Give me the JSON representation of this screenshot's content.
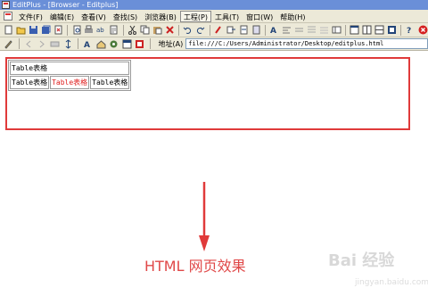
{
  "window": {
    "title": "EditPlus - [Browser - Editplus]"
  },
  "menu": {
    "items": [
      "文件(F)",
      "编辑(E)",
      "查看(V)",
      "查找(S)",
      "浏览器(B)",
      "工程(P)",
      "工具(T)",
      "窗口(W)",
      "帮助(H)"
    ],
    "active_index": 5
  },
  "address": {
    "label": "地址(A)",
    "url": "file:///C:/Users/Administrator/Desktop/editplus.html"
  },
  "page": {
    "table": {
      "row1": {
        "cell1": "Table表格"
      },
      "row2": {
        "cell1": "Table表格",
        "cell2": "Table表格",
        "cell3": "Table表格"
      }
    }
  },
  "annotation": {
    "caption": "HTML 网页效果",
    "accent_color": "#e03a3a"
  },
  "watermark": {
    "text": "Bai 经验",
    "sub": "jingyan.baidu.com"
  }
}
